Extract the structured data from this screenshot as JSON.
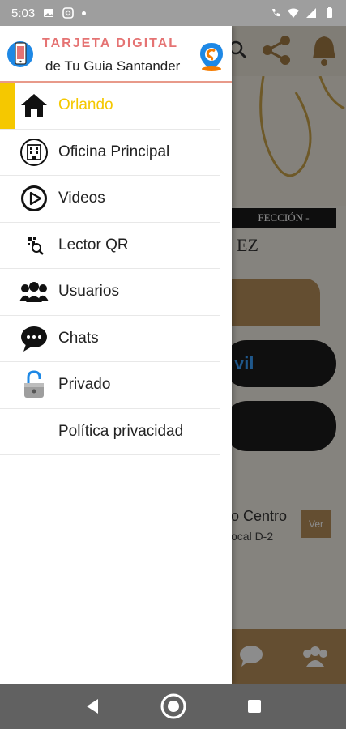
{
  "status_bar": {
    "time": "5:03"
  },
  "header": {
    "title": "TARJETA DIGITAL",
    "subtitle": "de Tu Guia Santander"
  },
  "menu": {
    "items": [
      {
        "label": "Orlando",
        "icon": "home-icon",
        "active": true
      },
      {
        "label": "Oficina Principal",
        "icon": "office-building-icon",
        "active": false
      },
      {
        "label": "Videos",
        "icon": "play-icon",
        "active": false
      },
      {
        "label": "Lector QR",
        "icon": "qr-scan-icon",
        "active": false
      },
      {
        "label": "Usuarios",
        "icon": "users-icon",
        "active": false
      },
      {
        "label": "Chats",
        "icon": "chat-icon",
        "active": false
      },
      {
        "label": "Privado",
        "icon": "unlocked-padlock-icon",
        "active": false
      },
      {
        "label": "Política privacidad",
        "icon": "",
        "active": false
      }
    ]
  },
  "background": {
    "banner_text": "FECCIÓN -",
    "script_text": "EZ",
    "pill_text": "vil",
    "location_line1": "o Centro",
    "location_line2": "ocal D-2",
    "ver_button": "Ver"
  },
  "colors": {
    "accent": "#f5c800",
    "brand_red": "#e57373",
    "tan": "#b78e5a",
    "status_bar": "#9e9e9e",
    "nav_bar": "#616161"
  }
}
